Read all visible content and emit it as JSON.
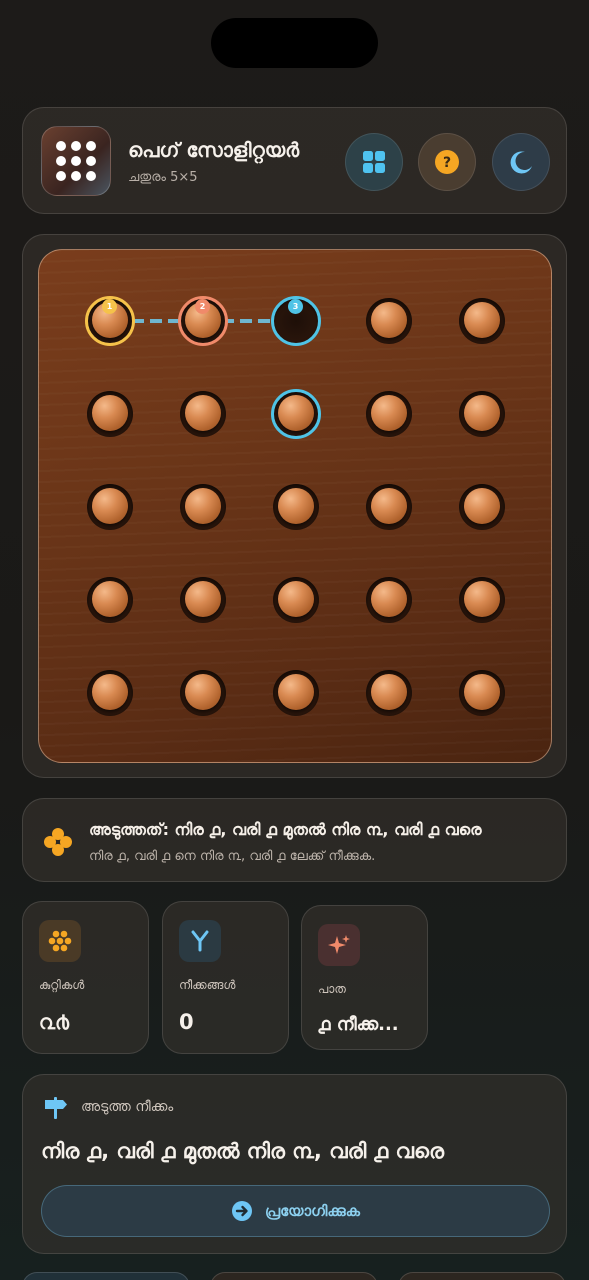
{
  "app": {
    "title": "പെഗ് സോളിറ്റയർ",
    "subtitle": "ചതുരം 5×5"
  },
  "header_buttons": [
    {
      "name": "grid-menu-button",
      "icon": "grid-icon",
      "color": "#4fc3f0"
    },
    {
      "name": "help-button",
      "icon": "question-icon",
      "color": "#f5a623"
    },
    {
      "name": "theme-button",
      "icon": "moon-icon",
      "color": "#6ec6f5"
    }
  ],
  "board": {
    "rows": 5,
    "cols": 5,
    "empty_holes": [
      [
        0,
        2
      ]
    ],
    "selected_from": [
      0,
      0
    ],
    "jumped_over": [
      0,
      1
    ],
    "target": [
      0,
      2
    ],
    "highlighted": [
      1,
      2
    ],
    "markers": {
      "from": {
        "label": "1",
        "color": "#f5c24a"
      },
      "over": {
        "label": "2",
        "color": "#f08a6a"
      },
      "to": {
        "label": "3",
        "color": "#4fc3e6"
      }
    }
  },
  "hint": {
    "title": "അടുത്തത്: നിര ൧, വരി ൧ മുതൽ നിര ൩, വരി ൧ വരെ",
    "subtitle": "നിര ൧, വരി ൧ നെ നിര ൩, വരി ൧ ലേക്ക് നീക്കുക."
  },
  "stats": [
    {
      "name": "pegs",
      "label": "കുറ്റികൾ",
      "value": "൨൪",
      "icon": "pegs-cluster-icon",
      "color": "#f5a623"
    },
    {
      "name": "moves",
      "label": "നീക്കങ്ങൾ",
      "value": "0",
      "icon": "fork-icon",
      "color": "#6ec6f5"
    },
    {
      "name": "path",
      "label": "പാത",
      "value": "൧ നീക്ക...",
      "icon": "sparkle-icon",
      "color": "#f08a6a"
    }
  ],
  "next_move": {
    "label": "അടുത്ത നീക്കം",
    "move": "നിര ൧, വരി ൧ മുതൽ നിര ൩, വരി ൧ വരെ",
    "apply_label": "പ്രയോഗിക്കുക"
  }
}
